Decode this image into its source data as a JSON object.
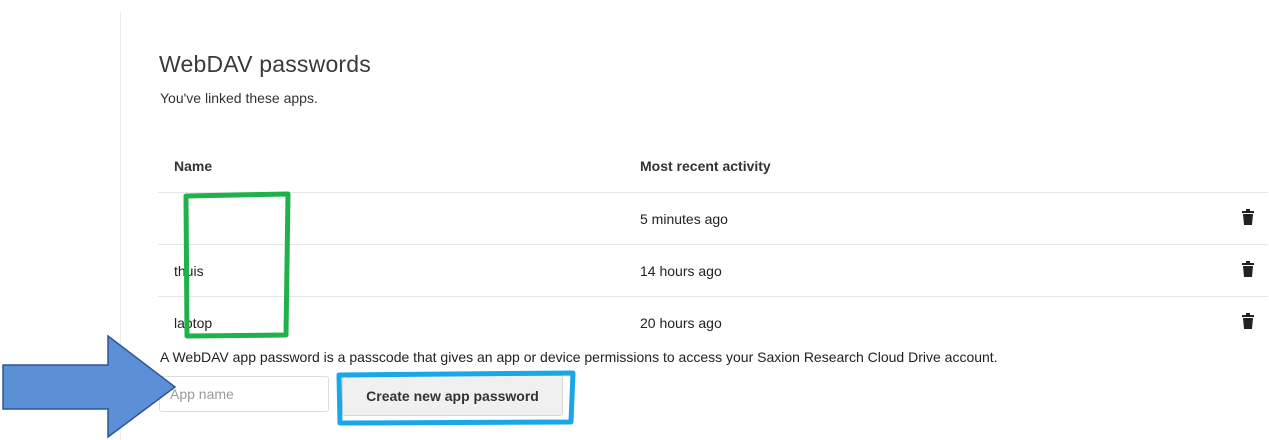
{
  "webdav": {
    "title": "WebDAV passwords",
    "description": "You've linked these apps.",
    "columns": {
      "name": "Name",
      "activity": "Most recent activity"
    },
    "rows": [
      {
        "name": "",
        "activity": "5 minutes ago"
      },
      {
        "name": "thuis",
        "activity": "14 hours ago"
      },
      {
        "name": "laptop",
        "activity": "20 hours ago"
      }
    ],
    "hint": "A WebDAV app password is a passcode that gives an app or device permissions to access your Saxion Research Cloud Drive account.",
    "input_placeholder": "App name",
    "create_label": "Create new app password"
  },
  "icons": {
    "delete": "trash-icon",
    "arrow": "arrow-right-annotation"
  },
  "colors": {
    "highlight_names": "#1fb24a",
    "highlight_button": "#1aa7e8",
    "arrow_fill": "#5b8fd6",
    "arrow_stroke": "#2f5597"
  }
}
